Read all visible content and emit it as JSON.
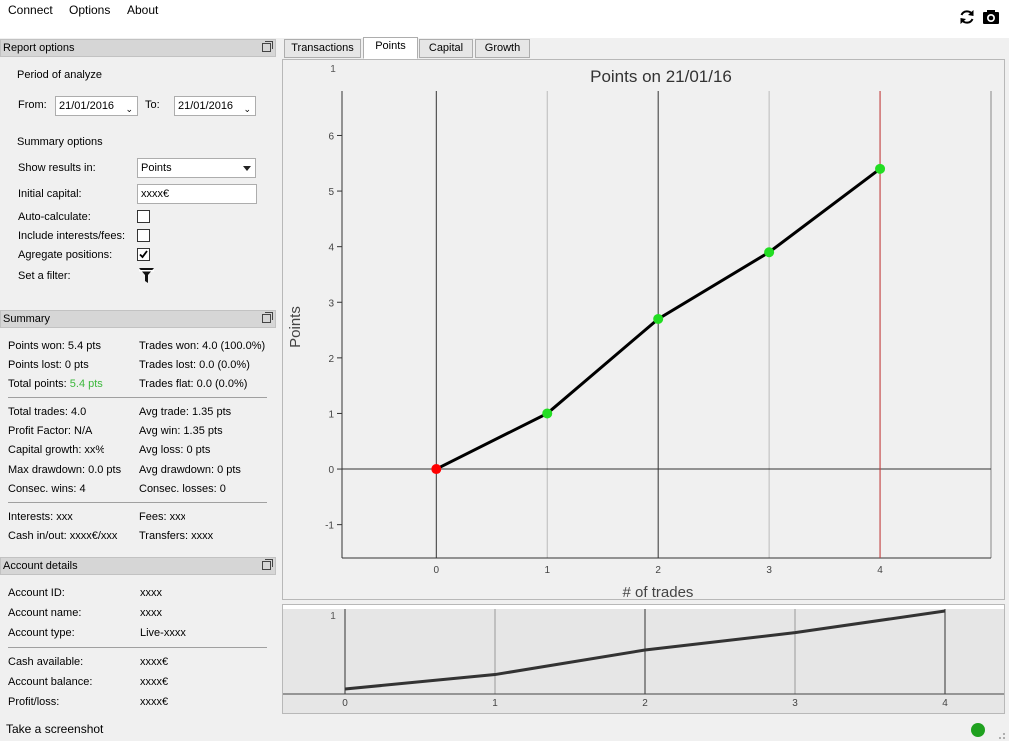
{
  "menu": [
    "Connect",
    "Options",
    "About"
  ],
  "toolbar": {
    "refresh_icon": "refresh-icon",
    "camera_icon": "camera-icon"
  },
  "report_options": {
    "title": "Report options",
    "period_heading": "Period of analyze",
    "from_label": "From:",
    "from_value": "21/01/2016",
    "to_label": "To:",
    "to_value": "21/01/2016",
    "summary_heading": "Summary options",
    "show_results_label": "Show results in:",
    "show_results_value": "Points",
    "initial_capital_label": "Initial capital:",
    "initial_capital_value": "xxxx€",
    "auto_calc_label": "Auto-calculate:",
    "auto_calc_checked": false,
    "include_label": "Include interests/fees:",
    "include_checked": false,
    "aggregate_label": "Agregate positions:",
    "aggregate_checked": true,
    "filter_label": "Set a filter:"
  },
  "summary": {
    "title": "Summary",
    "points_won": "Points won: 5.4 pts",
    "trades_won": "Trades won: 4.0 (100.0%)",
    "points_lost": "Points lost: 0 pts",
    "trades_lost": "Trades lost: 0.0 (0.0%)",
    "total_points_label": "Total points: ",
    "total_points_value": "5.4 pts",
    "trades_flat": "Trades flat: 0.0 (0.0%)",
    "total_trades": "Total trades: 4.0",
    "avg_trade": "Avg trade: 1.35 pts",
    "profit_factor": "Profit Factor: N/A",
    "avg_win": "Avg win: 1.35 pts",
    "capital_growth": "Capital growth: xx%",
    "avg_loss": "Avg loss: 0 pts",
    "max_drawdown": "Max drawdown: 0.0 pts",
    "avg_drawdown": "Avg drawdown: 0 pts",
    "consec_wins": "Consec. wins: 4",
    "consec_losses": "Consec. losses: 0",
    "interests": "Interests: xxx",
    "fees": "Fees: xxx",
    "cash_inout": "Cash in/out: xxxx€/xxx",
    "transfers": "Transfers: xxxx"
  },
  "account": {
    "title": "Account details",
    "rows": [
      {
        "label": "Account ID:",
        "value": "xxxx"
      },
      {
        "label": "Account name:",
        "value": "xxxx"
      },
      {
        "label": "Account type:",
        "value": "Live-xxxx"
      },
      {
        "label": "Cash available:",
        "value": "xxxx€"
      },
      {
        "label": "Account balance:",
        "value": "xxxx€"
      },
      {
        "label": "Profit/loss:",
        "value": "xxxx€"
      }
    ]
  },
  "tabs": [
    "Transactions",
    "Points",
    "Capital",
    "Growth"
  ],
  "active_tab": "Points",
  "status": {
    "text": "Take a screenshot",
    "indicator_color": "#1fa11f"
  },
  "colors": {
    "accent_green": "#22cc22",
    "start_point": "#ff0000",
    "marker_line": "#d04040",
    "total_points_text": "#3cb83c"
  },
  "chart_data": [
    {
      "type": "line",
      "title": "Points on 21/01/16",
      "xlabel": "# of trades",
      "ylabel": "Points",
      "x": [
        0,
        1,
        2,
        3,
        4
      ],
      "y": [
        0,
        1.0,
        2.7,
        3.9,
        5.4
      ],
      "point_colors": [
        "#ff0000",
        "#22dd22",
        "#22dd22",
        "#22dd22",
        "#22dd22"
      ],
      "xticks": [
        "0",
        "1",
        "2",
        "3",
        "4"
      ],
      "yticks": [
        "-1",
        "0",
        "1",
        "2",
        "3",
        "4",
        "5",
        "6"
      ],
      "xlim": [
        -0.85,
        5.0
      ],
      "ylim": [
        -1.6,
        6.8
      ],
      "grid": true,
      "marker_line_x": 4,
      "corner_label": "1"
    },
    {
      "type": "line",
      "title": "",
      "x": [
        0,
        1,
        2,
        3,
        4
      ],
      "y": [
        0,
        1.0,
        2.7,
        3.9,
        5.4
      ],
      "xticks": [
        "0",
        "1",
        "2",
        "3",
        "4"
      ],
      "corner_label": "1"
    }
  ]
}
